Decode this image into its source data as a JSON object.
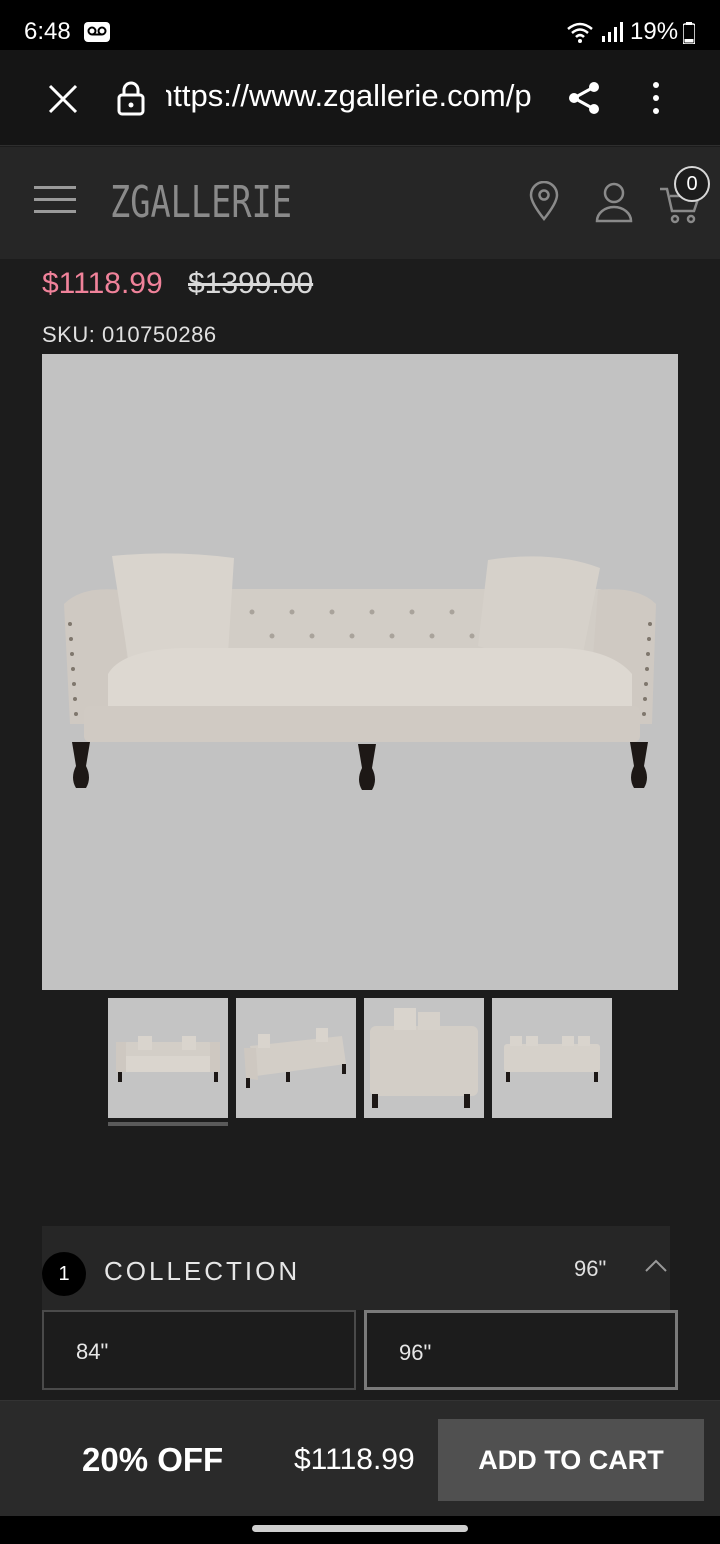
{
  "status_bar": {
    "time": "6:48",
    "battery": "19%"
  },
  "browser": {
    "url": "https://www.zgallerie.com/p"
  },
  "site_header": {
    "logo": "ZGALLERIE",
    "cart_count": "0"
  },
  "product": {
    "sale_price": "$1118.99",
    "original_price": "$1399.00",
    "sku": "SKU: 010750286",
    "thumbnail_count": 4,
    "selected_thumbnail": 1
  },
  "collection": {
    "step": "1",
    "title": "COLLECTION",
    "selected": "96\"",
    "options": [
      "84\"",
      "96\""
    ]
  },
  "bottom_bar": {
    "discount": "20% OFF",
    "price": "$1118.99",
    "add_to_cart": "ADD TO CART"
  },
  "colors": {
    "sale_price": "#f0829a",
    "background": "#1c1c1c",
    "header": "#262626",
    "button": "#505050"
  }
}
